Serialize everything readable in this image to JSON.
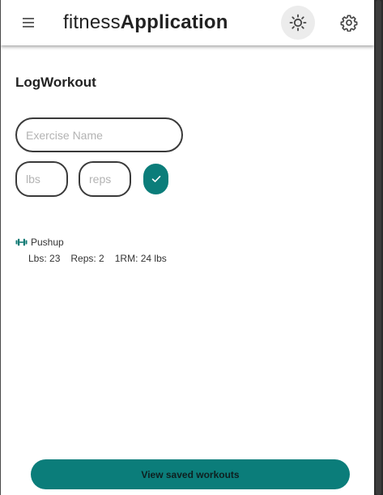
{
  "header": {
    "title_light": "fitness",
    "title_bold": "Application",
    "menu_icon": "hamburger-menu-icon",
    "theme_icon": "sun-icon",
    "settings_icon": "gear-icon"
  },
  "page": {
    "title_light": "Log",
    "title_bold": "Workout"
  },
  "form": {
    "exercise_placeholder": "Exercise Name",
    "exercise_value": "",
    "lbs_placeholder": "lbs",
    "lbs_value": "",
    "reps_placeholder": "reps",
    "reps_value": "",
    "submit_icon": "checkmark-icon"
  },
  "workouts": [
    {
      "icon": "dumbbell-icon",
      "name": "Pushup",
      "lbs": "Lbs: 23",
      "reps": "Reps: 2",
      "one_rm": "1RM: 24 lbs"
    }
  ],
  "footer": {
    "button_label": "View saved workouts"
  },
  "colors": {
    "accent": "#0b7d7a",
    "icon_teal": "#117a74",
    "text": "#222222",
    "border": "#3a3a3a",
    "placeholder": "#b3b3b3"
  }
}
